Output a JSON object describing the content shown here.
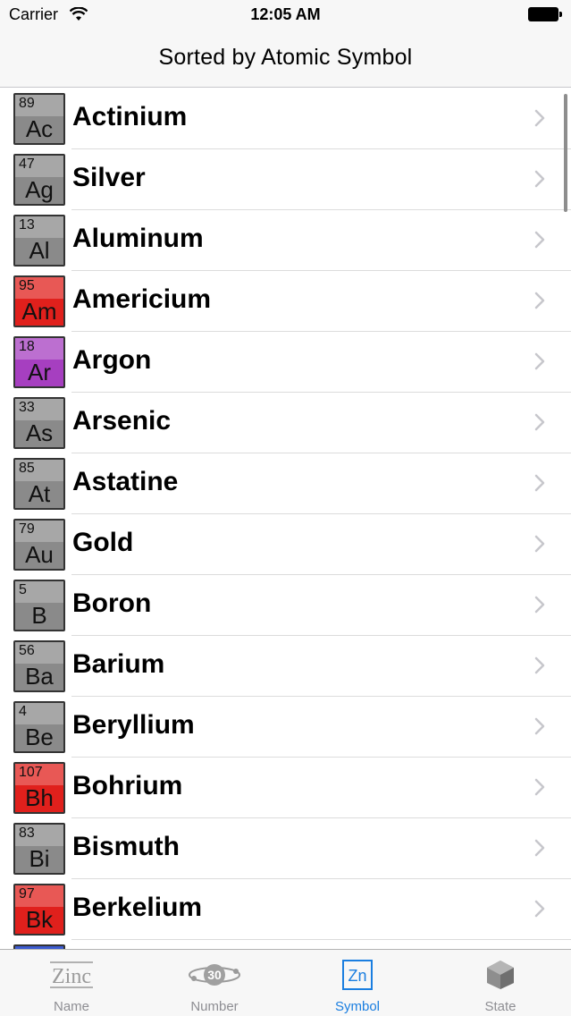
{
  "status_bar": {
    "carrier": "Carrier",
    "time": "12:05 AM"
  },
  "nav": {
    "title": "Sorted by Atomic Symbol"
  },
  "colors": {
    "gray_tile": "#8a8a8a",
    "red_tile": "#e0201c",
    "purple_tile": "#a63fc0",
    "accent": "#1a7ee0"
  },
  "elements": [
    {
      "number": "89",
      "symbol": "Ac",
      "name": "Actinium",
      "color": "#8a8a8a"
    },
    {
      "number": "47",
      "symbol": "Ag",
      "name": "Silver",
      "color": "#8a8a8a"
    },
    {
      "number": "13",
      "symbol": "Al",
      "name": "Aluminum",
      "color": "#8a8a8a"
    },
    {
      "number": "95",
      "symbol": "Am",
      "name": "Americium",
      "color": "#e0201c"
    },
    {
      "number": "18",
      "symbol": "Ar",
      "name": "Argon",
      "color": "#a63fc0"
    },
    {
      "number": "33",
      "symbol": "As",
      "name": "Arsenic",
      "color": "#8a8a8a"
    },
    {
      "number": "85",
      "symbol": "At",
      "name": "Astatine",
      "color": "#8a8a8a"
    },
    {
      "number": "79",
      "symbol": "Au",
      "name": "Gold",
      "color": "#8a8a8a"
    },
    {
      "number": "5",
      "symbol": "B",
      "name": "Boron",
      "color": "#8a8a8a"
    },
    {
      "number": "56",
      "symbol": "Ba",
      "name": "Barium",
      "color": "#8a8a8a"
    },
    {
      "number": "4",
      "symbol": "Be",
      "name": "Beryllium",
      "color": "#8a8a8a"
    },
    {
      "number": "107",
      "symbol": "Bh",
      "name": "Bohrium",
      "color": "#e0201c"
    },
    {
      "number": "83",
      "symbol": "Bi",
      "name": "Bismuth",
      "color": "#8a8a8a"
    },
    {
      "number": "97",
      "symbol": "Bk",
      "name": "Berkelium",
      "color": "#e0201c"
    }
  ],
  "tabs": [
    {
      "label": "Name",
      "icon": "zinc-text-icon",
      "icon_text": "Zinc"
    },
    {
      "label": "Number",
      "icon": "atom-number-icon",
      "icon_text": "30"
    },
    {
      "label": "Symbol",
      "icon": "symbol-tile-icon",
      "icon_text": "Zn"
    },
    {
      "label": "State",
      "icon": "cube-icon",
      "icon_text": ""
    }
  ]
}
